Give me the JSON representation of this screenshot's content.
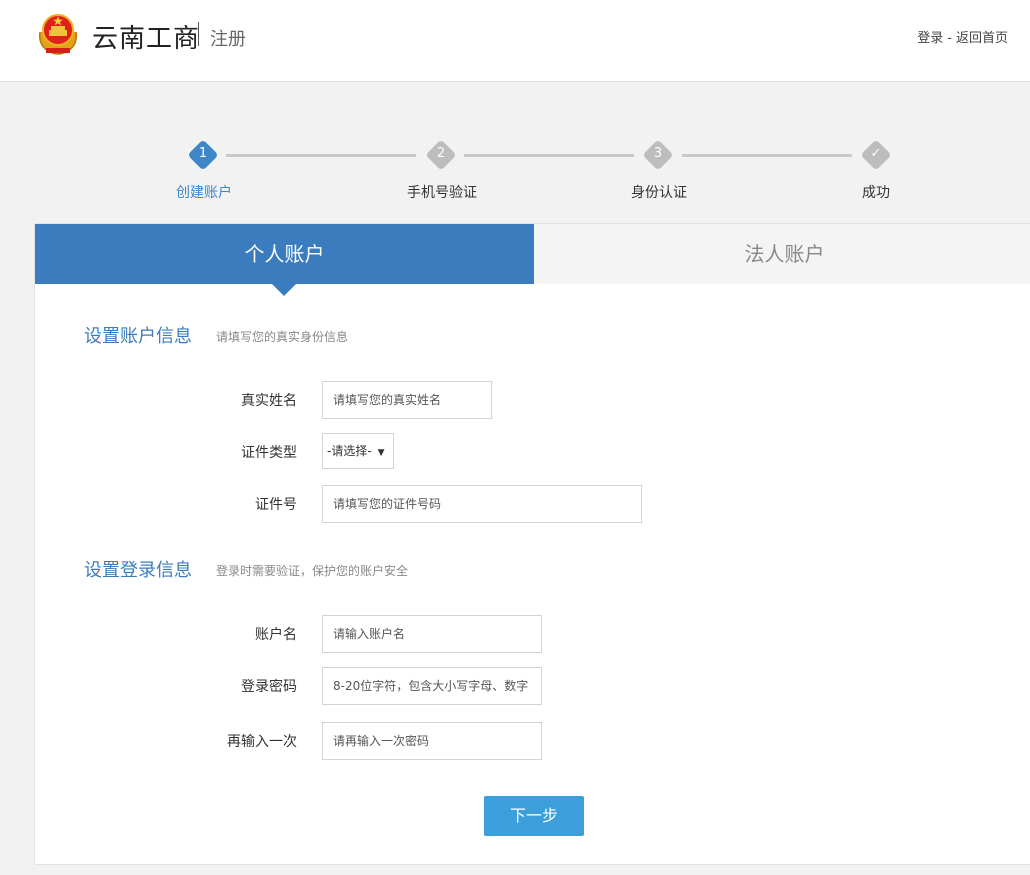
{
  "header": {
    "brand": "云南工商",
    "subtitle": "注册",
    "login_link": "登录",
    "separator": "-",
    "home_link": "返回首页"
  },
  "steps": [
    {
      "num": "1",
      "label": "创建账户",
      "active": true
    },
    {
      "num": "2",
      "label": "手机号验证",
      "active": false
    },
    {
      "num": "3",
      "label": "身份认证",
      "active": false
    },
    {
      "num": "✓",
      "label": "成功",
      "active": false
    }
  ],
  "tabs": {
    "personal": "个人账户",
    "corporate": "法人账户"
  },
  "account_info": {
    "title": "设置账户信息",
    "subtitle": "请填写您的真实身份信息",
    "real_name_label": "真实姓名",
    "real_name_placeholder": "请填写您的真实姓名",
    "id_type_label": "证件类型",
    "id_type_value": "-请选择-",
    "id_number_label": "证件号",
    "id_number_placeholder": "请填写您的证件号码"
  },
  "login_info": {
    "title": "设置登录信息",
    "subtitle": "登录时需要验证，保护您的账户安全",
    "username_label": "账户名",
    "username_placeholder": "请输入账户名",
    "password_label": "登录密码",
    "password_placeholder": "8-20位字符，包含大小写字母、数字",
    "confirm_label": "再输入一次",
    "confirm_placeholder": "请再输入一次密码"
  },
  "next_button": "下一步",
  "colors": {
    "primary": "#3b7cbf",
    "button": "#3c9fdb",
    "step_inactive": "#bdbdbd"
  }
}
